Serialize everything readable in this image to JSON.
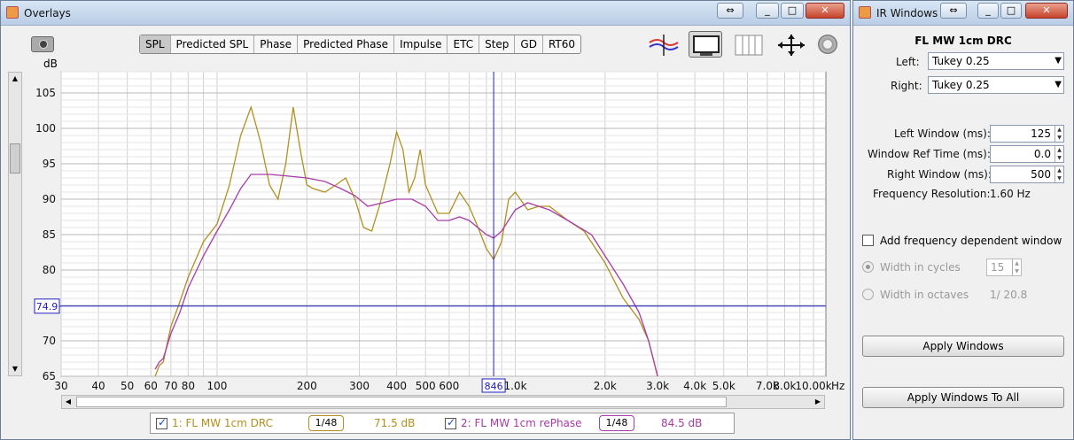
{
  "overlays": {
    "title": "Overlays",
    "tabs": [
      "SPL",
      "Predicted SPL",
      "Phase",
      "Predicted Phase",
      "Impulse",
      "ETC",
      "Step",
      "GD",
      "RT60"
    ],
    "active_tab": "SPL",
    "db_unit": "dB",
    "hz_unit": "Hz",
    "cursor_y_label": "74.9",
    "cursor_x_label": "846",
    "legend": [
      {
        "label": "1: FL MW 1cm DRC",
        "smoothing": "1/48",
        "level": "71.5 dB",
        "color": "#b0901e",
        "checked": true
      },
      {
        "label": "2: FL MW 1cm rePhase",
        "smoothing": "1/48",
        "level": "84.5 dB",
        "color": "#a63ca6",
        "checked": true
      }
    ]
  },
  "chart_data": {
    "type": "line",
    "xscale": "log",
    "xlim": [
      30,
      11000
    ],
    "ylim": [
      65,
      108
    ],
    "yticks": [
      65,
      70,
      75,
      80,
      85,
      90,
      95,
      100,
      105
    ],
    "xticks": [
      {
        "v": 30,
        "t": "30"
      },
      {
        "v": 40,
        "t": "40"
      },
      {
        "v": 50,
        "t": "50"
      },
      {
        "v": 60,
        "t": "60"
      },
      {
        "v": 70,
        "t": "70"
      },
      {
        "v": 80,
        "t": "80"
      },
      {
        "v": 100,
        "t": "100"
      },
      {
        "v": 200,
        "t": "200"
      },
      {
        "v": 300,
        "t": "300"
      },
      {
        "v": 400,
        "t": "400"
      },
      {
        "v": 500,
        "t": "500"
      },
      {
        "v": 600,
        "t": "600"
      },
      {
        "v": 800,
        "t": "8"
      },
      {
        "v": 1000,
        "t": "1.0k"
      },
      {
        "v": 2000,
        "t": "2.0k"
      },
      {
        "v": 3000,
        "t": "3.0k"
      },
      {
        "v": 4000,
        "t": "4.0k"
      },
      {
        "v": 5000,
        "t": "5.0k"
      },
      {
        "v": 7000,
        "t": "7.0k"
      },
      {
        "v": 8000,
        "t": "8.0k"
      },
      {
        "v": 10000,
        "t": "10.00k"
      }
    ],
    "cursor": {
      "x": 846,
      "y": 74.9
    },
    "grid": true,
    "series": [
      {
        "name": "1: FL MW 1cm DRC",
        "color": "#b0901e",
        "points": [
          [
            62,
            65
          ],
          [
            64,
            66.5
          ],
          [
            66,
            67
          ],
          [
            70,
            72
          ],
          [
            75,
            75.5
          ],
          [
            80,
            79
          ],
          [
            90,
            84
          ],
          [
            100,
            86.5
          ],
          [
            110,
            92
          ],
          [
            120,
            99
          ],
          [
            130,
            103
          ],
          [
            140,
            98
          ],
          [
            150,
            92
          ],
          [
            160,
            90
          ],
          [
            170,
            95
          ],
          [
            180,
            103
          ],
          [
            190,
            97
          ],
          [
            200,
            92
          ],
          [
            210,
            91.5
          ],
          [
            230,
            91
          ],
          [
            250,
            92
          ],
          [
            270,
            93
          ],
          [
            290,
            90
          ],
          [
            310,
            86
          ],
          [
            330,
            85.5
          ],
          [
            350,
            89
          ],
          [
            380,
            95
          ],
          [
            400,
            99.5
          ],
          [
            420,
            97
          ],
          [
            440,
            91
          ],
          [
            460,
            93
          ],
          [
            480,
            97
          ],
          [
            500,
            92
          ],
          [
            550,
            88
          ],
          [
            600,
            88
          ],
          [
            650,
            91
          ],
          [
            700,
            89
          ],
          [
            750,
            86
          ],
          [
            800,
            83
          ],
          [
            846,
            81.5
          ],
          [
            900,
            84
          ],
          [
            950,
            90
          ],
          [
            1000,
            91
          ],
          [
            1100,
            88.5
          ],
          [
            1200,
            89
          ],
          [
            1300,
            89
          ],
          [
            1500,
            87
          ],
          [
            1700,
            85.5
          ],
          [
            2000,
            81
          ],
          [
            2300,
            76
          ],
          [
            2600,
            73
          ],
          [
            2800,
            70
          ],
          [
            3000,
            65
          ]
        ]
      },
      {
        "name": "2: FL MW 1cm rePhase",
        "color": "#a63ca6",
        "points": [
          [
            62,
            66
          ],
          [
            64,
            67
          ],
          [
            66,
            67.5
          ],
          [
            70,
            71
          ],
          [
            75,
            74
          ],
          [
            80,
            77.5
          ],
          [
            90,
            82
          ],
          [
            100,
            85.5
          ],
          [
            110,
            88.5
          ],
          [
            120,
            91.5
          ],
          [
            130,
            93.5
          ],
          [
            150,
            93.5
          ],
          [
            170,
            93.3
          ],
          [
            200,
            93
          ],
          [
            230,
            92.5
          ],
          [
            260,
            91.5
          ],
          [
            290,
            90.5
          ],
          [
            320,
            89
          ],
          [
            360,
            89.5
          ],
          [
            400,
            90
          ],
          [
            450,
            90
          ],
          [
            500,
            89
          ],
          [
            550,
            87
          ],
          [
            600,
            87
          ],
          [
            650,
            87.5
          ],
          [
            700,
            87
          ],
          [
            800,
            85
          ],
          [
            846,
            84.5
          ],
          [
            900,
            85.5
          ],
          [
            1000,
            88.5
          ],
          [
            1100,
            89.5
          ],
          [
            1300,
            88.5
          ],
          [
            1500,
            87
          ],
          [
            1800,
            85
          ],
          [
            2000,
            82
          ],
          [
            2300,
            78
          ],
          [
            2600,
            74
          ],
          [
            2800,
            70
          ],
          [
            3000,
            65
          ]
        ]
      }
    ]
  },
  "ir_windows": {
    "title": "IR Windows",
    "heading": "FL MW 1cm DRC",
    "left_label": "Left:",
    "left_value": "Tukey 0.25",
    "right_label": "Right:",
    "right_value": "Tukey 0.25",
    "left_window_label": "Left Window (ms):",
    "left_window_value": "125",
    "ref_time_label": "Window Ref Time (ms):",
    "ref_time_value": "0.0",
    "right_window_label": "Right Window (ms):",
    "right_window_value": "500",
    "freq_res_label": "Frequency Resolution:",
    "freq_res_value": "1.60 Hz",
    "add_freq_label": "Add frequency dependent window",
    "width_cycles_label": "Width in cycles",
    "width_cycles_value": "15",
    "width_octaves_label": "Width in octaves",
    "width_octaves_value": "1/ 20.8",
    "apply_label": "Apply Windows",
    "apply_all_label": "Apply Windows To All"
  }
}
